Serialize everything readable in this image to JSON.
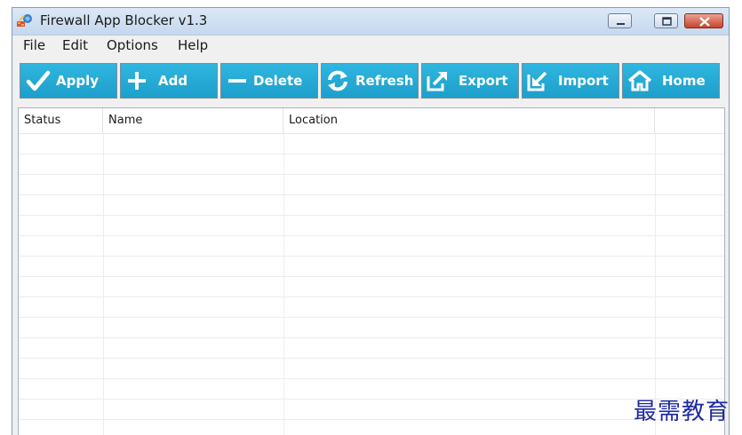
{
  "window": {
    "title": "Firewall App Blocker v1.3"
  },
  "menu": {
    "items": [
      "File",
      "Edit",
      "Options",
      "Help"
    ]
  },
  "toolbar": {
    "color": "#23a9d6",
    "buttons": [
      {
        "label": "Apply",
        "icon": "checkmark-icon"
      },
      {
        "label": "Add",
        "icon": "plus-icon"
      },
      {
        "label": "Delete",
        "icon": "minus-icon"
      },
      {
        "label": "Refresh",
        "icon": "refresh-icon"
      },
      {
        "label": "Export",
        "icon": "export-arrow-icon"
      },
      {
        "label": "Import",
        "icon": "import-arrow-icon"
      },
      {
        "label": "Home",
        "icon": "home-icon"
      }
    ]
  },
  "list": {
    "columns": [
      "Status",
      "Name",
      "Location",
      ""
    ],
    "rows": []
  },
  "watermark": "最需教育"
}
